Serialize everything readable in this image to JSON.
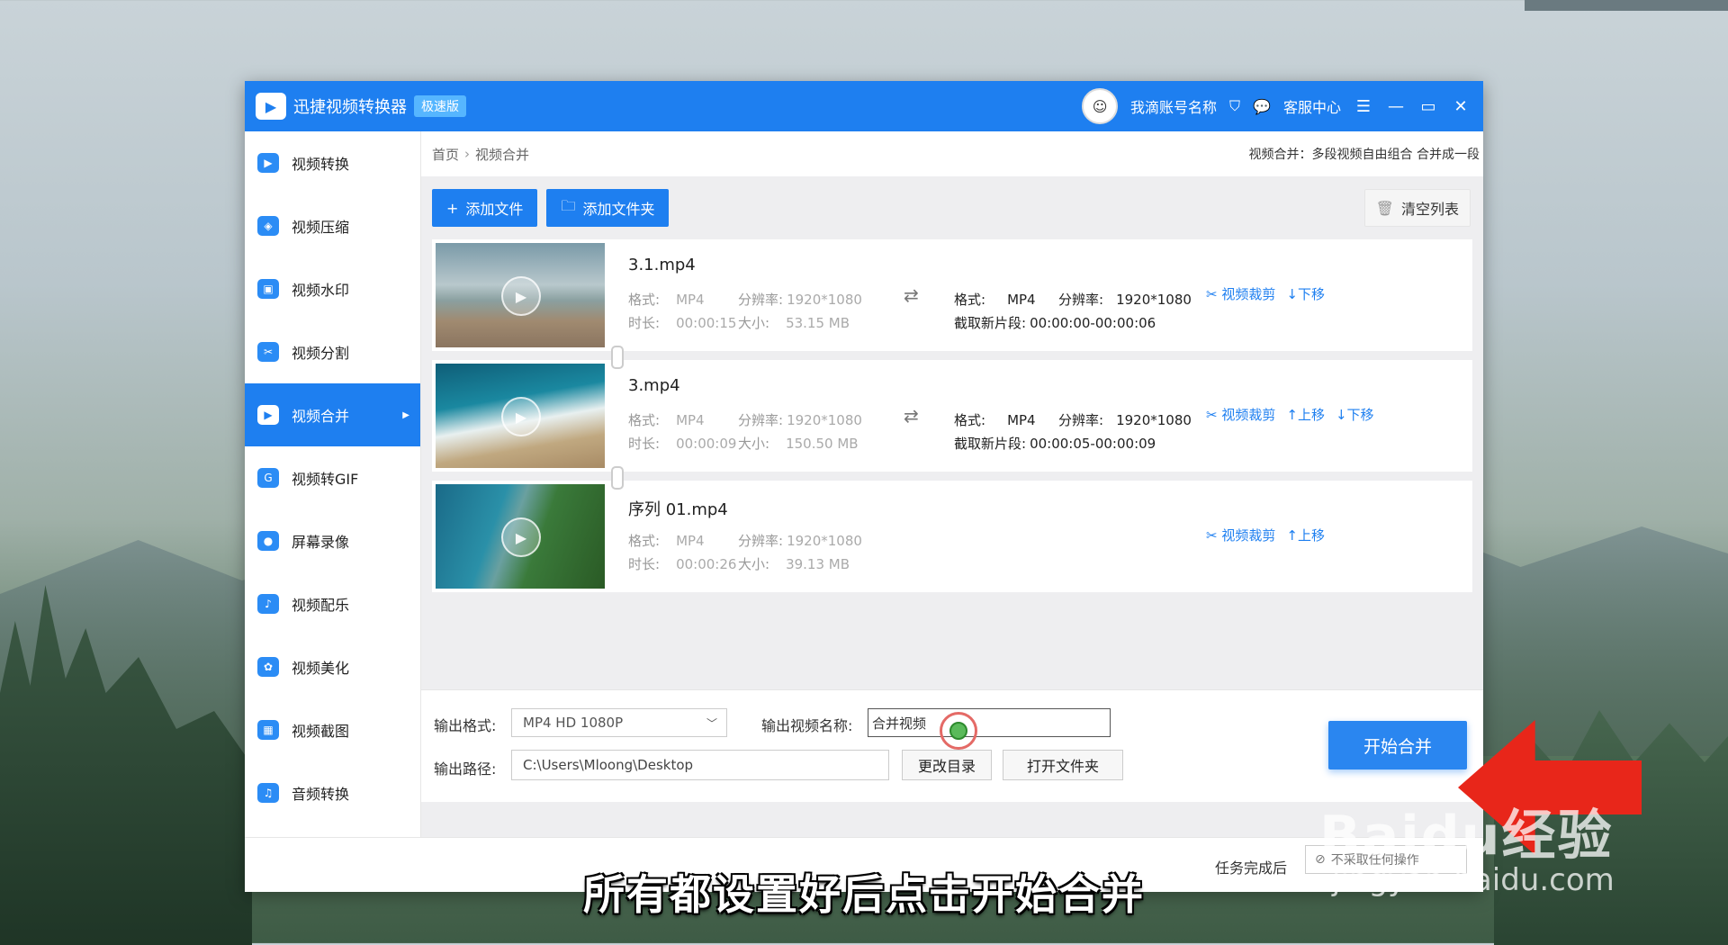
{
  "window": {
    "app_title": "迅捷视频转换器",
    "badge": "极速版",
    "account_name": "我滴账号名称",
    "service_center": "客服中心"
  },
  "sidebar": {
    "items": [
      {
        "label": "视频转换",
        "icon": "video-convert-icon"
      },
      {
        "label": "视频压缩",
        "icon": "video-compress-icon"
      },
      {
        "label": "视频水印",
        "icon": "video-watermark-icon"
      },
      {
        "label": "视频分割",
        "icon": "video-split-icon"
      },
      {
        "label": "视频合并",
        "icon": "video-merge-icon",
        "active": true
      },
      {
        "label": "视频转GIF",
        "icon": "video-gif-icon"
      },
      {
        "label": "屏幕录像",
        "icon": "screen-record-icon"
      },
      {
        "label": "视频配乐",
        "icon": "video-music-icon"
      },
      {
        "label": "视频美化",
        "icon": "video-beautify-icon"
      },
      {
        "label": "视频截图",
        "icon": "video-screenshot-icon"
      },
      {
        "label": "音频转换",
        "icon": "audio-convert-icon"
      }
    ]
  },
  "breadcrumb": {
    "home": "首页",
    "current": "视频合并",
    "description": "视频合并：多段视频自由组合 合并成一段"
  },
  "toolbar": {
    "add_file": "添加文件",
    "add_folder": "添加文件夹",
    "clear_list": "清空列表"
  },
  "labels": {
    "format": "格式:",
    "resolution": "分辨率:",
    "duration": "时长:",
    "size": "大小:",
    "out_format": "格式:",
    "out_resolution": "分辨率:",
    "clip": "截取新片段:",
    "crop": "视频裁剪",
    "move_up": "上移",
    "move_down": "下移"
  },
  "files": [
    {
      "name": "3.1.mp4",
      "format": "MP4",
      "resolution": "1920*1080",
      "duration": "00:00:15",
      "size": "53.15 MB",
      "out_format": "MP4",
      "out_resolution": "1920*1080",
      "clip": "00:00:00-00:00:06"
    },
    {
      "name": "3.mp4",
      "format": "MP4",
      "resolution": "1920*1080",
      "duration": "00:00:09",
      "size": "150.50 MB",
      "out_format": "MP4",
      "out_resolution": "1920*1080",
      "clip": "00:00:05-00:00:09"
    },
    {
      "name": "序列 01.mp4",
      "format": "MP4",
      "resolution": "1920*1080",
      "duration": "00:00:26",
      "size": "39.13 MB"
    }
  ],
  "output": {
    "format_label": "输出格式:",
    "format_value": "MP4   HD 1080P",
    "name_label": "输出视频名称:",
    "name_value": "合并视频",
    "path_label": "输出路径:",
    "path_value": "C:\\Users\\Mloong\\Desktop",
    "change_dir": "更改目录",
    "open_folder": "打开文件夹",
    "start": "开始合并"
  },
  "status": {
    "after_label": "任务完成后",
    "after_value": "不采取任何操作"
  },
  "overlay": {
    "subtitle": "所有都设置好后点击开始合并",
    "watermark": "Baidu经验",
    "watermark_url": "jingyan.baidu.com"
  },
  "colors": {
    "accent": "#1e7ff0",
    "arrow": "#e8261a"
  }
}
